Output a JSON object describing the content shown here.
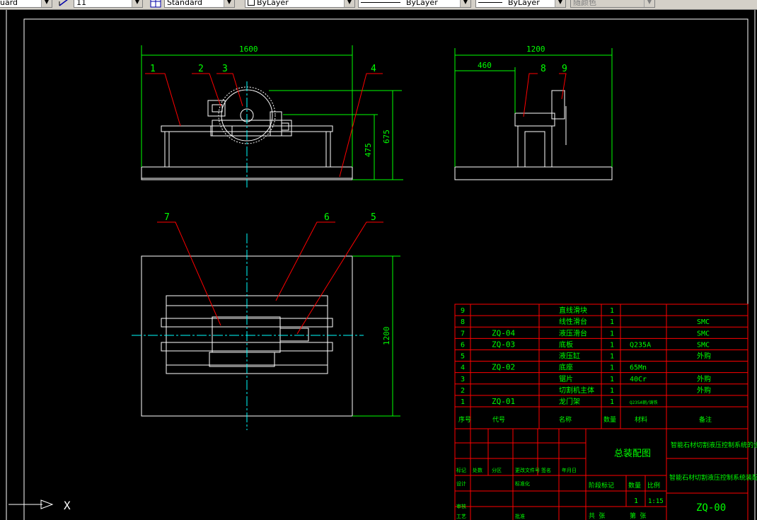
{
  "toolbar": {
    "text_style": "uard",
    "dim_style_value": "11",
    "table_style": "Standard",
    "layer": "ByLayer",
    "linetype": "ByLayer",
    "lineweight": "ByLayer",
    "plot_style": "随颜色"
  },
  "colors": {
    "background": "#000000",
    "frame": "#ffffff",
    "dimension": "#00ff00",
    "leader": "#ff0000",
    "center": "#00ffff",
    "table_grid": "#ff0000",
    "text": "#00ff00"
  },
  "views": {
    "front": {
      "dim_width": "1600",
      "dim_h1": "475",
      "dim_h2": "675",
      "balloons": [
        "1",
        "2",
        "3",
        "4"
      ]
    },
    "side": {
      "dim_width": "1200",
      "dim_offset": "460",
      "balloons": [
        "8",
        "9"
      ]
    },
    "top": {
      "dim_height": "1200",
      "balloons": [
        "7",
        "6",
        "5"
      ]
    }
  },
  "bom": {
    "rows": [
      {
        "no": "9",
        "code": "",
        "name": "直线滑块",
        "qty": "1",
        "material": "",
        "note": ""
      },
      {
        "no": "8",
        "code": "",
        "name": "线性滑台",
        "qty": "1",
        "material": "",
        "note": "SMC"
      },
      {
        "no": "7",
        "code": "ZQ-04",
        "name": "液压滑台",
        "qty": "1",
        "material": "",
        "note": "SMC"
      },
      {
        "no": "6",
        "code": "ZQ-03",
        "name": "底板",
        "qty": "1",
        "material": "Q235A",
        "note": "SMC"
      },
      {
        "no": "5",
        "code": "",
        "name": "液压缸",
        "qty": "1",
        "material": "",
        "note": "外购"
      },
      {
        "no": "4",
        "code": "ZQ-02",
        "name": "底座",
        "qty": "1",
        "material": "65Mn",
        "note": ""
      },
      {
        "no": "3",
        "code": "",
        "name": "锯片",
        "qty": "1",
        "material": "40Cr",
        "note": "外购"
      },
      {
        "no": "2",
        "code": "",
        "name": "切割机主体",
        "qty": "1",
        "material": "",
        "note": "外购"
      },
      {
        "no": "1",
        "code": "ZQ-01",
        "name": "龙门架",
        "qty": "1",
        "material": "Q235A钢/铸铁",
        "note": ""
      }
    ],
    "header": {
      "no": "序号",
      "code": "代号",
      "name": "名称",
      "qty": "数量",
      "material": "材料",
      "note": "备注"
    }
  },
  "title_block": {
    "drawing_title": "总装配图",
    "project": "智能石材切割液压控制系统的设计",
    "subtitle": "智能石材切割液压控制系统装配图",
    "drawing_no": "ZQ-00",
    "quantity": "1",
    "scale": "1:15",
    "labels": {
      "stage": "阶段标记",
      "qty": "数量",
      "scale": "比例",
      "mark": "标记",
      "count": "处数",
      "zone": "分区",
      "docno": "更改文件号",
      "sign": "签名",
      "date": "年月日",
      "design": "设计",
      "std": "标准化",
      "check": "审核",
      "process": "工艺",
      "approve": "批准",
      "total": "共 张",
      "sheet": "第 张"
    }
  },
  "ucs": {
    "x_label": "X"
  }
}
